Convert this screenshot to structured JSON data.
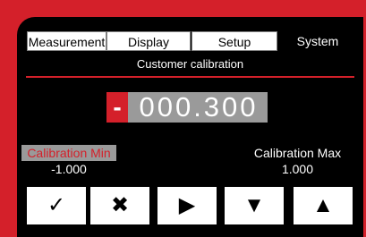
{
  "tabs": [
    {
      "label": "Measurement",
      "active": false
    },
    {
      "label": "Display",
      "active": false
    },
    {
      "label": "Setup",
      "active": false
    },
    {
      "label": "System",
      "active": true
    }
  ],
  "page_subtitle": "Customer calibration",
  "value": {
    "sign": "-",
    "digits": "000.300"
  },
  "calibration_min": {
    "label": "Calibration Min",
    "value": "-1.000",
    "selected": true
  },
  "calibration_max": {
    "label": "Calibration Max",
    "value": "1.000"
  },
  "buttons": [
    {
      "name": "confirm",
      "glyph": "✓",
      "icon": "checkmark-icon"
    },
    {
      "name": "cancel",
      "glyph": "✖",
      "icon": "close-icon"
    },
    {
      "name": "next",
      "glyph": "▶",
      "icon": "arrow-right-icon"
    },
    {
      "name": "decrement",
      "glyph": "▼",
      "icon": "arrow-down-icon"
    },
    {
      "name": "increment",
      "glyph": "▲",
      "icon": "arrow-up-icon"
    }
  ],
  "colors": {
    "accent": "#d4202a",
    "screen_background": "#000000",
    "highlight_gray": "#9a9a9a"
  }
}
